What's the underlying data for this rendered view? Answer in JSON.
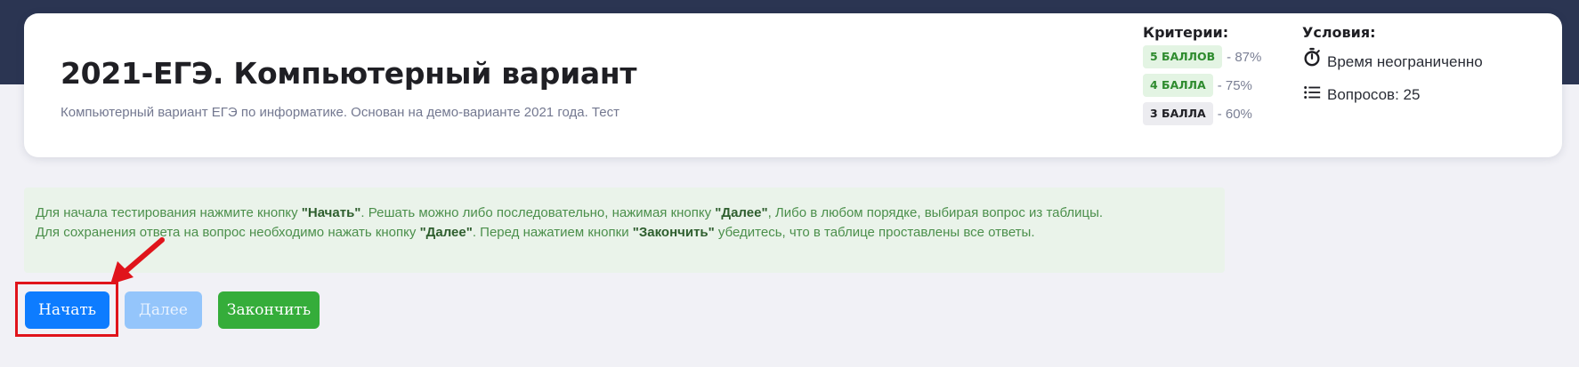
{
  "header": {
    "title": "2021-ЕГЭ. Компьютерный вариант",
    "subtitle": "Компьютерный вариант ЕГЭ по информатике. Основан на демо-варианте 2021 года. Тест"
  },
  "criteria": {
    "heading": "Критерии:",
    "items": [
      {
        "badge": "5 БАЛЛОВ",
        "percent": "- 87%",
        "style": "green"
      },
      {
        "badge": "4 БАЛЛА",
        "percent": "- 75%",
        "style": "green"
      },
      {
        "badge": "3 БАЛЛА",
        "percent": "- 60%",
        "style": "gray"
      }
    ]
  },
  "conditions": {
    "heading": "Условия:",
    "time": "Время неограниченно",
    "time_icon": "stopwatch-icon",
    "questions": "Вопросов: 25",
    "questions_icon": "list-icon"
  },
  "info": {
    "line1": {
      "t1": "Для начала тестирования нажмите кнопку ",
      "b1": "\"Начать\"",
      "t2": ". Решать можно либо последовательно, нажимая кнопку ",
      "b2": "\"Далее\"",
      "t3": ", Либо в любом порядке, выбирая вопрос из таблицы."
    },
    "line2": {
      "t1": "Для сохранения ответа на вопрос необходимо нажать кнопку ",
      "b1": "\"Далее\"",
      "t2": ". Перед нажатием кнопки ",
      "b2": "\"Закончить\"",
      "t3": " убедитесь, что в таблице проставлены все ответы."
    }
  },
  "buttons": {
    "start": "Начать",
    "next": "Далее",
    "finish": "Закончить"
  },
  "colors": {
    "header_band": "#2b3552",
    "primary": "#0d7cff",
    "success": "#35ad3a",
    "annotation": "#e0141b"
  }
}
